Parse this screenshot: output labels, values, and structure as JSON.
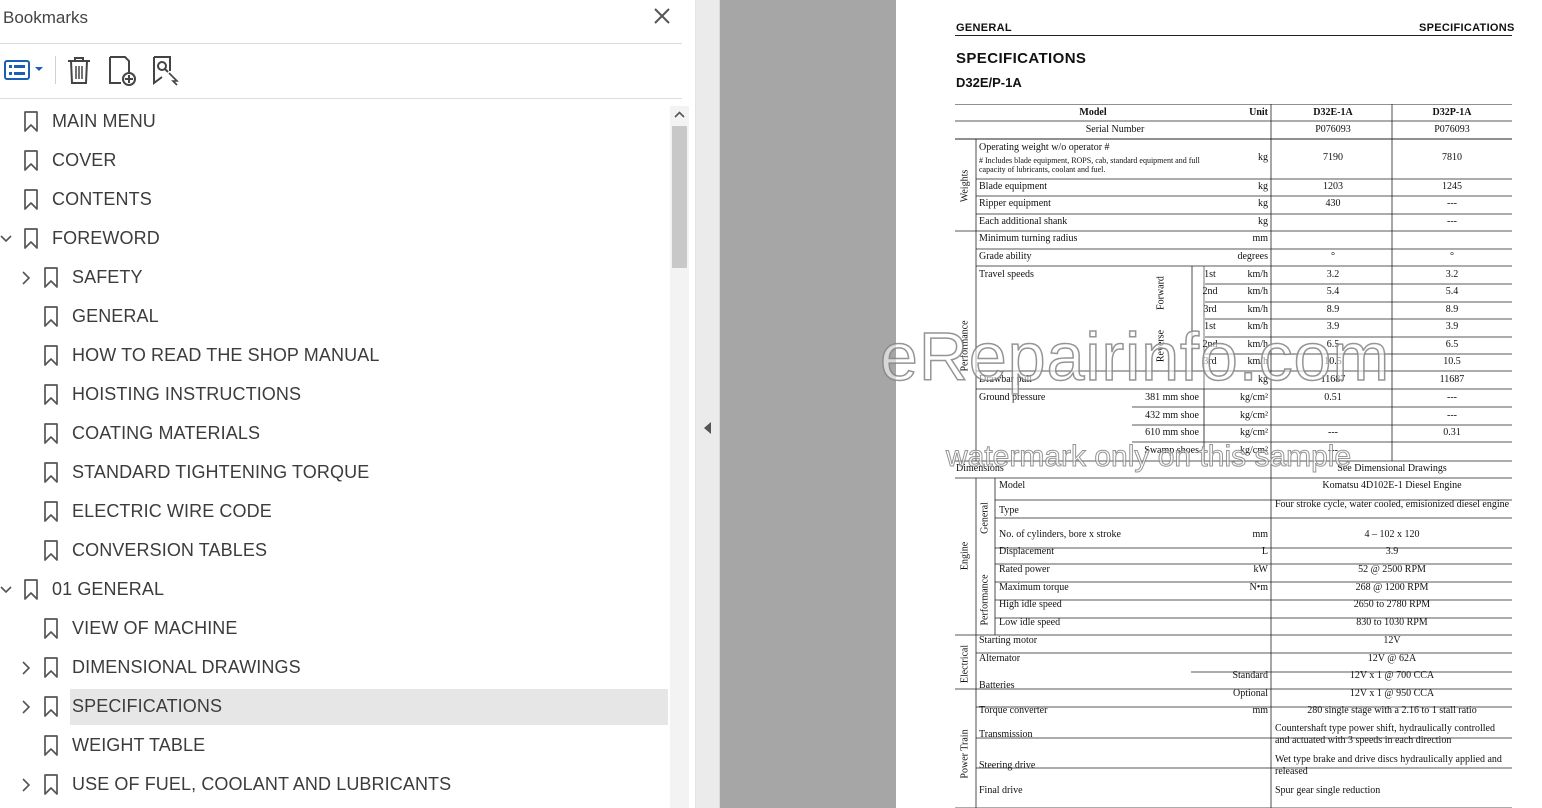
{
  "panel": {
    "title": "Bookmarks",
    "toolbar": {
      "options": "list-options-icon",
      "delete": "trash-icon",
      "add": "add-bookmark-icon",
      "find": "find-bookmark-icon"
    }
  },
  "bookmarks": [
    {
      "label": "MAIN MENU",
      "level": 0,
      "chevron": "none"
    },
    {
      "label": "COVER",
      "level": 0,
      "chevron": "none"
    },
    {
      "label": "CONTENTS",
      "level": 0,
      "chevron": "none"
    },
    {
      "label": "FOREWORD",
      "level": 0,
      "chevron": "expanded"
    },
    {
      "label": "SAFETY",
      "level": 1,
      "chevron": "collapsed"
    },
    {
      "label": "GENERAL",
      "level": 1,
      "chevron": "none"
    },
    {
      "label": "HOW TO READ THE SHOP MANUAL",
      "level": 1,
      "chevron": "none"
    },
    {
      "label": "HOISTING INSTRUCTIONS",
      "level": 1,
      "chevron": "none"
    },
    {
      "label": "COATING MATERIALS",
      "level": 1,
      "chevron": "none"
    },
    {
      "label": "STANDARD TIGHTENING TORQUE",
      "level": 1,
      "chevron": "none"
    },
    {
      "label": "ELECTRIC WIRE CODE",
      "level": 1,
      "chevron": "none"
    },
    {
      "label": "CONVERSION TABLES",
      "level": 1,
      "chevron": "none"
    },
    {
      "label": "01 GENERAL",
      "level": 0,
      "chevron": "expanded"
    },
    {
      "label": "VIEW OF MACHINE",
      "level": 1,
      "chevron": "none"
    },
    {
      "label": "DIMENSIONAL DRAWINGS",
      "level": 1,
      "chevron": "collapsed"
    },
    {
      "label": "SPECIFICATIONS",
      "level": 1,
      "chevron": "collapsed",
      "selected": true
    },
    {
      "label": "WEIGHT TABLE",
      "level": 1,
      "chevron": "none"
    },
    {
      "label": "USE OF FUEL, COOLANT AND LUBRICANTS",
      "level": 1,
      "chevron": "collapsed"
    }
  ],
  "document": {
    "running_header_left": "GENERAL",
    "running_header_right": "SPECIFICATIONS",
    "title": "SPECIFICATIONS",
    "subtitle": "D32E/P-1A",
    "watermark": "eRepairinfo.com",
    "watermark_sub": "watermark only on this sample",
    "table": {
      "headers": {
        "model": "Model",
        "unit": "Unit",
        "col1": "D32E-1A",
        "col2": "D32P-1A"
      },
      "groups": {
        "weights": "Weights",
        "performance": "Performance",
        "forward": "Forward",
        "reverse": "Reverse",
        "engine": "Engine",
        "general": "General",
        "eng_performance": "Performance",
        "electrical": "Electrical",
        "power_train": "Power Train"
      },
      "serial": {
        "label": "Serial Number",
        "v1": "P076093",
        "v2": "P076093"
      },
      "op_weight": {
        "label": "Operating weight w/o operator #",
        "note": "#   Includes blade equipment, ROPS, cab, standard equipment and full capacity of lubricants, coolant and fuel.",
        "unit": "kg",
        "v1": "7190",
        "v2": "7810"
      },
      "blade": {
        "label": "Blade equipment",
        "unit": "kg",
        "v1": "1203",
        "v2": "1245"
      },
      "ripper": {
        "label": "Ripper equipment",
        "unit": "kg",
        "v1": "430",
        "v2": "---"
      },
      "shank": {
        "label": "Each additional shank",
        "unit": "kg",
        "v1": "",
        "v2": "---"
      },
      "turning": {
        "label": "Minimum turning radius",
        "unit": "mm",
        "v1": "",
        "v2": ""
      },
      "grade": {
        "label": "Grade ability",
        "unit": "degrees",
        "v1": "°",
        "v2": "°"
      },
      "travel_label": "Travel speeds",
      "travel": [
        {
          "gear": "1st",
          "unit": "km/h",
          "v1": "3.2",
          "v2": "3.2"
        },
        {
          "gear": "2nd",
          "unit": "km/h",
          "v1": "5.4",
          "v2": "5.4"
        },
        {
          "gear": "3rd",
          "unit": "km/h",
          "v1": "8.9",
          "v2": "8.9"
        },
        {
          "gear": "1st",
          "unit": "km/h",
          "v1": "3.9",
          "v2": "3.9"
        },
        {
          "gear": "2nd",
          "unit": "km/h",
          "v1": "6.5",
          "v2": "6.5"
        },
        {
          "gear": "3rd",
          "unit": "km/h",
          "v1": "10.5",
          "v2": "10.5"
        }
      ],
      "drawbar": {
        "label": "Drawbar pull",
        "unit": "kg",
        "v1": "11687",
        "v2": "11687"
      },
      "ground_label": "Ground pressure",
      "ground": [
        {
          "shoe": "381 mm shoe",
          "unit": "kg/cm²",
          "v1": "0.51",
          "v2": "---"
        },
        {
          "shoe": "432 mm shoe",
          "unit": "kg/cm²",
          "v1": "",
          "v2": "---"
        },
        {
          "shoe": "610 mm shoe",
          "unit": "kg/cm²",
          "v1": "---",
          "v2": "0.31"
        },
        {
          "shoe": "Swamp shoes",
          "unit": "kg/cm²",
          "v1": "---",
          "v2": ""
        }
      ],
      "dimensions": {
        "label": "Dimensions",
        "value": "See Dimensional Drawings"
      },
      "engine_model": {
        "label": "Model",
        "value": "Komatsu 4D102E-1 Diesel Engine"
      },
      "engine_type": {
        "label": "Type",
        "value": "Four stroke cycle, water cooled, emisionized diesel engine"
      },
      "cylinders": {
        "label": "No. of cylinders, bore x stroke",
        "unit": "mm",
        "value": "4 – 102 x 120"
      },
      "displacement": {
        "label": "Displacement",
        "unit": "L",
        "value": "3.9"
      },
      "rated_power": {
        "label": "Rated power",
        "unit": "kW",
        "value": "52 @ 2500 RPM"
      },
      "max_torque": {
        "label": "Maximum torque",
        "unit": "N•m",
        "value": "268 @ 1200 RPM"
      },
      "high_idle": {
        "label": "High idle speed",
        "value": "2650 to 2780 RPM"
      },
      "low_idle": {
        "label": "Low idle speed",
        "value": "830 to 1030 RPM"
      },
      "starting": {
        "label": "Starting motor",
        "value": "12V"
      },
      "alternator": {
        "label": "Alternator",
        "value": "12V @ 62A"
      },
      "batteries": {
        "label": "Batteries",
        "std_label": "Standard",
        "std_value": "12V x 1 @ 700 CCA",
        "opt_label": "Optional",
        "opt_value": "12V x 1 @ 950 CCA"
      },
      "torque_conv": {
        "label": "Torque converter",
        "unit": "mm",
        "value": "280 single stage with a 2.16 to 1 stall ratio"
      },
      "transmission": {
        "label": "Transmission",
        "value": "Countershaft type power shift, hydraulically controlled and actuated with 3 speeds in each direction"
      },
      "steering": {
        "label": "Steering drive",
        "value": "Wet type brake and drive discs hydraulically applied and released"
      },
      "final_drive": {
        "label": "Final drive",
        "value": "Spur gear single reduction"
      }
    }
  }
}
